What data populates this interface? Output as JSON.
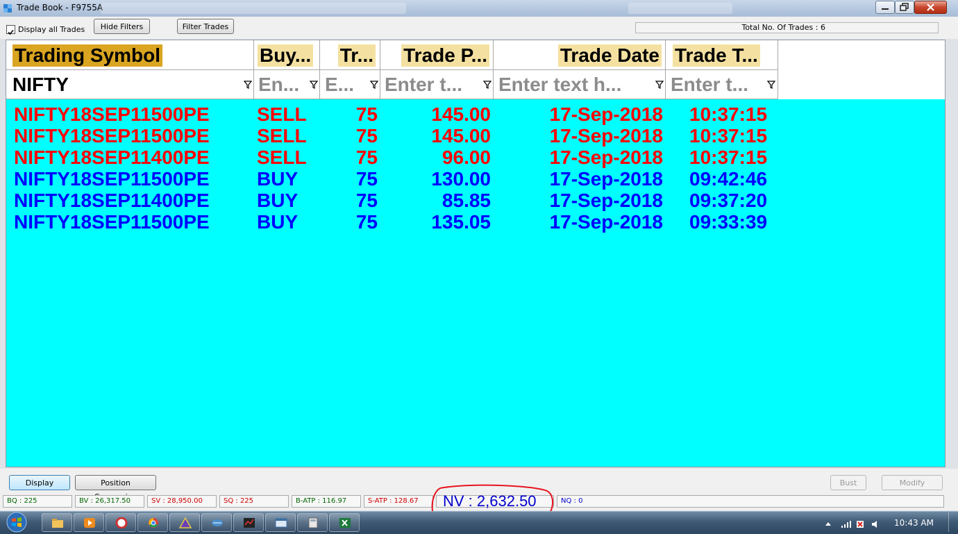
{
  "window": {
    "title": "Trade Book - F9755A"
  },
  "toolbar": {
    "display_all_label": "Display all Trades",
    "display_all_checked": true,
    "hide_filters_label": "Hide Filters",
    "filter_trades_label": "Filter Trades",
    "total_trades": "Total No. Of Trades : 6"
  },
  "grid": {
    "headers": [
      "Trading Symbol",
      "Buy...",
      "Tr...",
      "Trade P...",
      "Trade Date",
      "Trade T..."
    ],
    "filters": [
      "NIFTY",
      "En...",
      "E...",
      "Enter t...",
      "Enter text h...",
      "Enter t..."
    ],
    "rows": [
      {
        "symbol": "NIFTY18SEP11500PE",
        "side": "SELL",
        "qty": "75",
        "price": "145.00",
        "date": "17-Sep-2018",
        "time": "10:37:15"
      },
      {
        "symbol": "NIFTY18SEP11500PE",
        "side": "SELL",
        "qty": "75",
        "price": "145.00",
        "date": "17-Sep-2018",
        "time": "10:37:15"
      },
      {
        "symbol": "NIFTY18SEP11400PE",
        "side": "SELL",
        "qty": "75",
        "price": "96.00",
        "date": "17-Sep-2018",
        "time": "10:37:15"
      },
      {
        "symbol": "NIFTY18SEP11500PE",
        "side": "BUY",
        "qty": "75",
        "price": "130.00",
        "date": "17-Sep-2018",
        "time": "09:42:46"
      },
      {
        "symbol": "NIFTY18SEP11400PE",
        "side": "BUY",
        "qty": "75",
        "price": "85.85",
        "date": "17-Sep-2018",
        "time": "09:37:20"
      },
      {
        "symbol": "NIFTY18SEP11500PE",
        "side": "BUY",
        "qty": "75",
        "price": "135.05",
        "date": "17-Sep-2018",
        "time": "09:33:39"
      }
    ],
    "colors": {
      "sell": "#ff0000",
      "buy": "#0000ff",
      "background": "#00ffff"
    }
  },
  "actions": {
    "display_label": "Display",
    "position_conversion_label": "Position Conversion",
    "bust_label": "Bust",
    "modify_label": "Modify"
  },
  "stats": {
    "bq": "BQ : 225",
    "bv": "BV : 26,317.50",
    "sv": "SV : 28,950.00",
    "sq": "SQ : 225",
    "batp": "B-ATP : 116.97",
    "satp": "S-ATP : 128.67",
    "nv": "NV : 2,632.50",
    "nq": "NQ : 0"
  },
  "taskbar": {
    "clock": "10:43 AM"
  }
}
